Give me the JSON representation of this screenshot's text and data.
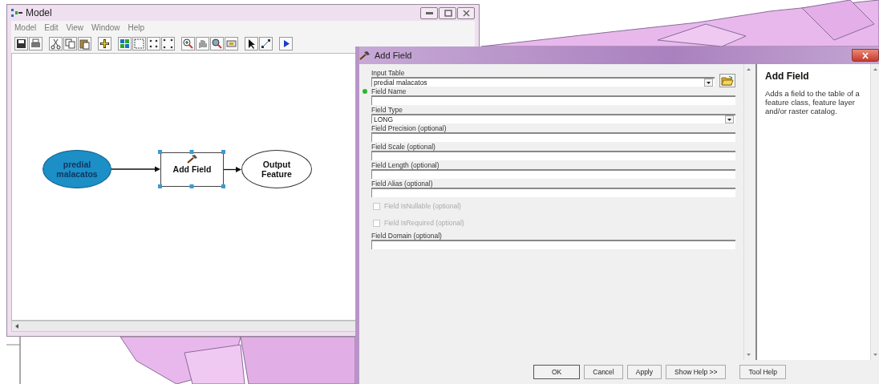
{
  "model_window": {
    "title": "Model",
    "menu": [
      "Model",
      "Edit",
      "View",
      "Window",
      "Help"
    ],
    "diagram": {
      "nodes": [
        {
          "kind": "input-data",
          "label": "predial malacatos",
          "selected": false
        },
        {
          "kind": "tool",
          "label": "Add Field",
          "selected": true
        },
        {
          "kind": "output-data",
          "label": "Output Feature",
          "selected": false
        }
      ]
    }
  },
  "dialog": {
    "title": "Add Field",
    "parameters": [
      {
        "kind": "combo",
        "label": "Input Table",
        "value": "predial malacatos",
        "browse": true,
        "required": false
      },
      {
        "kind": "text",
        "label": "Field Name",
        "required": true
      },
      {
        "kind": "combo",
        "label": "Field Type",
        "value": "LONG",
        "browse": false,
        "required": false
      },
      {
        "kind": "text",
        "label": "Field Precision (optional)",
        "required": false
      },
      {
        "kind": "text",
        "label": "Field Scale (optional)",
        "required": false
      },
      {
        "kind": "text",
        "label": "Field Length (optional)",
        "required": false
      },
      {
        "kind": "text",
        "label": "Field Alias (optional)",
        "required": false
      },
      {
        "kind": "checkbox",
        "label": "Field IsNullable (optional)",
        "checked": false,
        "disabled": true
      },
      {
        "kind": "checkbox",
        "label": "Field IsRequired (optional)",
        "checked": false,
        "disabled": true
      },
      {
        "kind": "text",
        "label": "Field Domain (optional)",
        "required": false
      }
    ],
    "help": {
      "title": "Add Field",
      "text": "Adds a field to the table of a feature class, feature layer and/or raster catalog."
    },
    "buttons": [
      {
        "label": "OK",
        "default": true
      },
      {
        "label": "Cancel",
        "default": false
      },
      {
        "label": "Apply",
        "default": false
      },
      {
        "label": "Show Help >>",
        "default": false
      },
      {
        "label": "Tool Help",
        "default": false
      }
    ]
  }
}
